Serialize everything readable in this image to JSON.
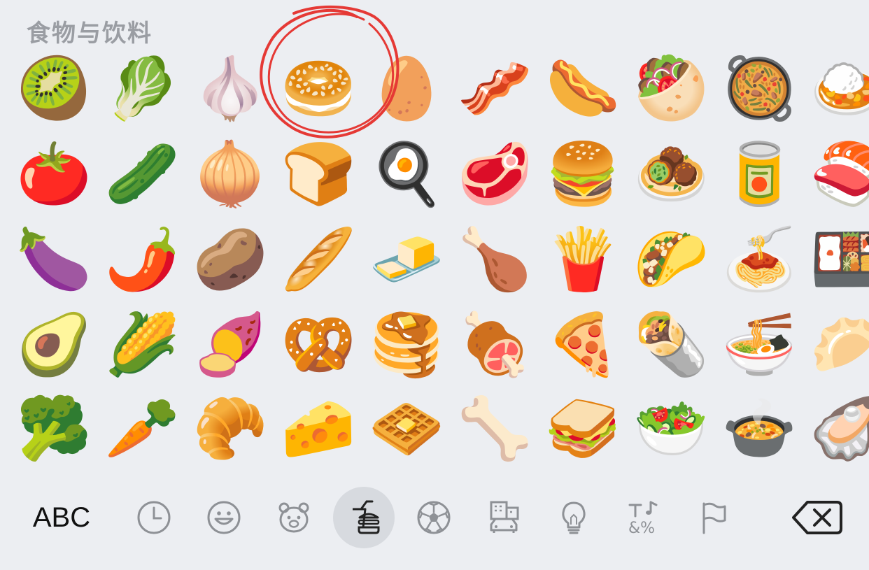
{
  "section": {
    "title": "食物与饮料"
  },
  "emoji_rows": [
    [
      {
        "glyph": "🥝",
        "name": "kiwi"
      },
      {
        "glyph": "🥬",
        "name": "leafy-green"
      },
      {
        "glyph": "🧄",
        "name": "garlic"
      },
      {
        "glyph": "🥯",
        "name": "bagel"
      },
      {
        "glyph": "🥚",
        "name": "egg"
      },
      {
        "glyph": "🥓",
        "name": "bacon"
      },
      {
        "glyph": "🌭",
        "name": "hot-dog"
      },
      {
        "glyph": "🥙",
        "name": "stuffed-flatbread"
      },
      {
        "glyph": "🥘",
        "name": "shallow-pan-food"
      },
      {
        "glyph": "🍛",
        "name": "curry-rice"
      }
    ],
    [
      {
        "glyph": "🍅",
        "name": "tomato"
      },
      {
        "glyph": "🥒",
        "name": "cucumber"
      },
      {
        "glyph": "🧅",
        "name": "onion"
      },
      {
        "glyph": "🍞",
        "name": "bread"
      },
      {
        "glyph": "🍳",
        "name": "cooking"
      },
      {
        "glyph": "🥩",
        "name": "cut-of-meat"
      },
      {
        "glyph": "🍔",
        "name": "hamburger"
      },
      {
        "glyph": "🧆",
        "name": "falafel"
      },
      {
        "glyph": "🥫",
        "name": "canned-food"
      },
      {
        "glyph": "🍣",
        "name": "sushi"
      }
    ],
    [
      {
        "glyph": "🍆",
        "name": "eggplant"
      },
      {
        "glyph": "🌶️",
        "name": "hot-pepper"
      },
      {
        "glyph": "🥔",
        "name": "potato"
      },
      {
        "glyph": "🥖",
        "name": "baguette"
      },
      {
        "glyph": "🧈",
        "name": "butter"
      },
      {
        "glyph": "🍗",
        "name": "poultry-leg"
      },
      {
        "glyph": "🍟",
        "name": "french-fries"
      },
      {
        "glyph": "🌮",
        "name": "taco"
      },
      {
        "glyph": "🍝",
        "name": "spaghetti"
      },
      {
        "glyph": "🍱",
        "name": "bento-box"
      }
    ],
    [
      {
        "glyph": "🥑",
        "name": "avocado"
      },
      {
        "glyph": "🌽",
        "name": "corn"
      },
      {
        "glyph": "🍠",
        "name": "sweet-potato"
      },
      {
        "glyph": "🥨",
        "name": "pretzel"
      },
      {
        "glyph": "🥞",
        "name": "pancakes"
      },
      {
        "glyph": "🍖",
        "name": "meat-on-bone"
      },
      {
        "glyph": "🍕",
        "name": "pizza"
      },
      {
        "glyph": "🌯",
        "name": "burrito"
      },
      {
        "glyph": "🍜",
        "name": "noodles"
      },
      {
        "glyph": "🥟",
        "name": "dumpling"
      }
    ],
    [
      {
        "glyph": "🥦",
        "name": "broccoli"
      },
      {
        "glyph": "🥕",
        "name": "carrot"
      },
      {
        "glyph": "🥐",
        "name": "croissant"
      },
      {
        "glyph": "🧀",
        "name": "cheese"
      },
      {
        "glyph": "🧇",
        "name": "waffle"
      },
      {
        "glyph": "🦴",
        "name": "bone"
      },
      {
        "glyph": "🥪",
        "name": "sandwich"
      },
      {
        "glyph": "🥗",
        "name": "green-salad"
      },
      {
        "glyph": "🍲",
        "name": "pot-of-food"
      },
      {
        "glyph": "🦪",
        "name": "oyster"
      }
    ]
  ],
  "toolbar": {
    "abc_label": "ABC",
    "categories": [
      {
        "name": "recent",
        "icon": "clock-icon"
      },
      {
        "name": "smileys",
        "icon": "smiley-icon"
      },
      {
        "name": "animals",
        "icon": "bear-icon"
      },
      {
        "name": "food",
        "icon": "food-drink-icon",
        "active": true
      },
      {
        "name": "activity",
        "icon": "soccer-ball-icon"
      },
      {
        "name": "travel",
        "icon": "building-car-icon"
      },
      {
        "name": "objects",
        "icon": "lightbulb-icon"
      },
      {
        "name": "symbols",
        "icon": "symbols-icon"
      },
      {
        "name": "flags",
        "icon": "flag-icon"
      }
    ],
    "backspace_icon": "backspace-icon"
  },
  "colors": {
    "background": "#eceef2",
    "title": "#9a9da3",
    "icon_stroke": "#8e9196",
    "active_bg": "#d7dadf",
    "annotation": "#e53935"
  }
}
